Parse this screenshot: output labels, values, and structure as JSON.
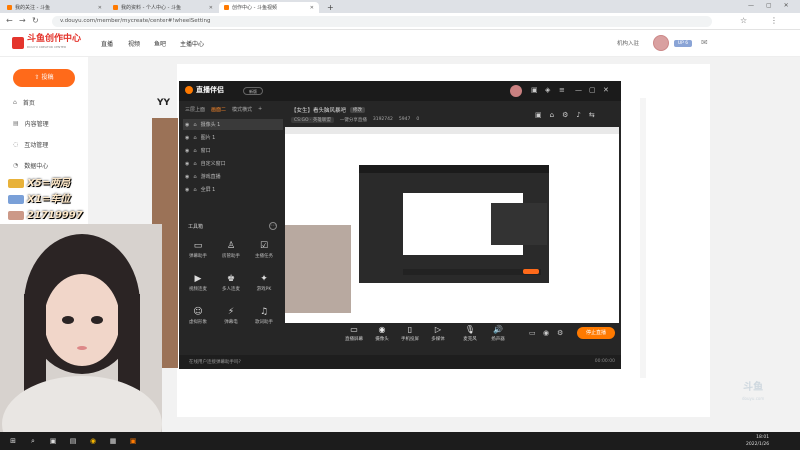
{
  "browser": {
    "tabs": [
      {
        "label": "我的关注 - 斗鱼",
        "active": false
      },
      {
        "label": "我的资料 - 个人中心 - 斗鱼",
        "active": false
      },
      {
        "label": "创作中心 - 斗鱼视频",
        "active": true
      }
    ],
    "new_tab": "+",
    "url": "v.douyu.com/member/mycreate/center#!wheelSetting"
  },
  "site": {
    "logo_text": "斗鱼创作中心",
    "logo_sub": "DOUYU CREATOR CENTER",
    "nav": [
      "直播",
      "视频",
      "鱼吧",
      "主播中心"
    ],
    "user_link": "机构入驻",
    "level_badge": "UP 6",
    "upload_label": "投稿",
    "sidebar": [
      "首页",
      "内容管理",
      "互动管理",
      "数据中心"
    ]
  },
  "bg_brand": "YY",
  "app": {
    "name": "直播伴侣",
    "version": "新版",
    "scene_tabs": [
      "三层上面",
      "画面二",
      "模式横式"
    ],
    "sources": [
      {
        "label": "摄像头 1",
        "tag": "",
        "selected": true
      },
      {
        "label": "图片 1",
        "tag": "",
        "selected": false
      },
      {
        "label": "窗口",
        "tag": "",
        "selected": false
      },
      {
        "label": "自定义窗口",
        "tag": "",
        "selected": false
      },
      {
        "label": "游戏直播",
        "tag": "",
        "selected": false
      },
      {
        "label": "全屏 1",
        "tag": "",
        "selected": false
      }
    ],
    "tools_title": "工具箱",
    "tools": [
      {
        "label": "弹幕助手",
        "icon": "chat-icon"
      },
      {
        "label": "房管助手",
        "icon": "user-icon"
      },
      {
        "label": "主播任务",
        "icon": "task-icon"
      },
      {
        "label": "视频连麦",
        "icon": "video-icon"
      },
      {
        "label": "多人连麦",
        "icon": "multi-user-icon"
      },
      {
        "label": "游戏PK",
        "icon": "game-icon"
      },
      {
        "label": "虚拟形象",
        "icon": "avatar-icon"
      },
      {
        "label": "弹幕电",
        "icon": "bolt-icon"
      },
      {
        "label": "歌词助手",
        "icon": "music-icon"
      }
    ],
    "stream_title": "【女生】看头脑风暴吧",
    "edit_label": "修改",
    "category": "CS:GO · 英雄联盟",
    "stats": [
      "一键分享直播",
      "3192742",
      "5947",
      "0"
    ],
    "bottom_buttons": [
      {
        "label": "直播屏幕",
        "icon": "screen-icon"
      },
      {
        "label": "摄像头",
        "icon": "camera-icon"
      },
      {
        "label": "手机投屏",
        "icon": "phone-icon"
      },
      {
        "label": "多媒体",
        "icon": "media-icon"
      },
      {
        "label": "麦克风",
        "icon": "mic-icon"
      },
      {
        "label": "扬声器",
        "icon": "speaker-icon"
      }
    ],
    "go_live": "停止直播",
    "status_left": "在线用户连接弹幕助手吗?",
    "status_right": "00:00:00"
  },
  "overlay": {
    "lines": [
      "X5=两局",
      "X1=车位",
      "21719997"
    ]
  },
  "taskbar": {
    "time": "18:01",
    "date": "2022/1/26"
  },
  "watermark": {
    "main": "斗鱼",
    "sub": "douyu.com"
  }
}
